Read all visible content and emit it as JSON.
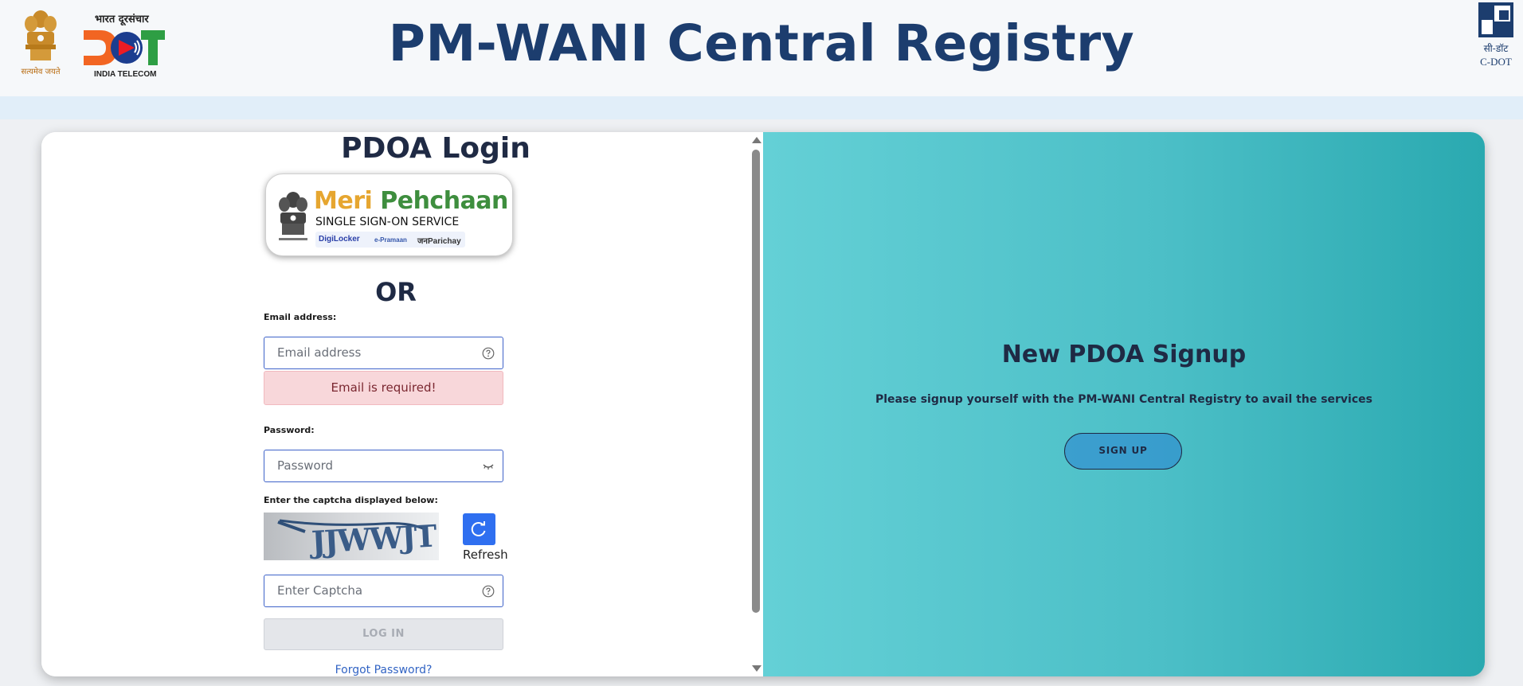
{
  "header": {
    "title": "PM-WANI Central Registry",
    "emblem_motto": "सत्यमेव जयते",
    "dot_hindi": "भारत दूरसंचार",
    "dot_english": "INDIA TELECOM",
    "cdot_hindi": "सी-डॉट",
    "cdot_english": "C-DOT"
  },
  "login": {
    "title": "PDOA Login",
    "sso": {
      "title_part1": "Meri",
      "title_part2": "Pehchaan",
      "subtitle": "SINGLE SIGN-ON SERVICE",
      "partners": [
        "DigiLocker",
        "e-Pramaan",
        "जनParichay"
      ]
    },
    "or_text": "OR",
    "email_label": "Email address:",
    "email_placeholder": "Email address",
    "email_error": "Email is required!",
    "password_label": "Password:",
    "password_placeholder": "Password",
    "captcha_label": "Enter the captcha displayed below:",
    "captcha_text": "JJWWJT",
    "refresh_label": "Refresh",
    "captcha_placeholder": "Enter Captcha",
    "login_button": "LOG IN",
    "forgot_password": "Forgot Password?"
  },
  "signup": {
    "title": "New PDOA Signup",
    "description": "Please signup yourself with the PM-WANI Central Registry to avail the services",
    "button": "SIGN UP"
  },
  "colors": {
    "header_title": "#1c3d6e",
    "primary_button": "#2f6ff0",
    "error_background": "#f8d7da",
    "signup_gradient_start": "#64d0d6",
    "signup_gradient_end": "#2aa9b0"
  },
  "icons": {
    "email_help": "question-circle-icon",
    "password_toggle": "eye-closed-icon",
    "captcha_help": "question-circle-icon",
    "refresh": "refresh-icon"
  }
}
